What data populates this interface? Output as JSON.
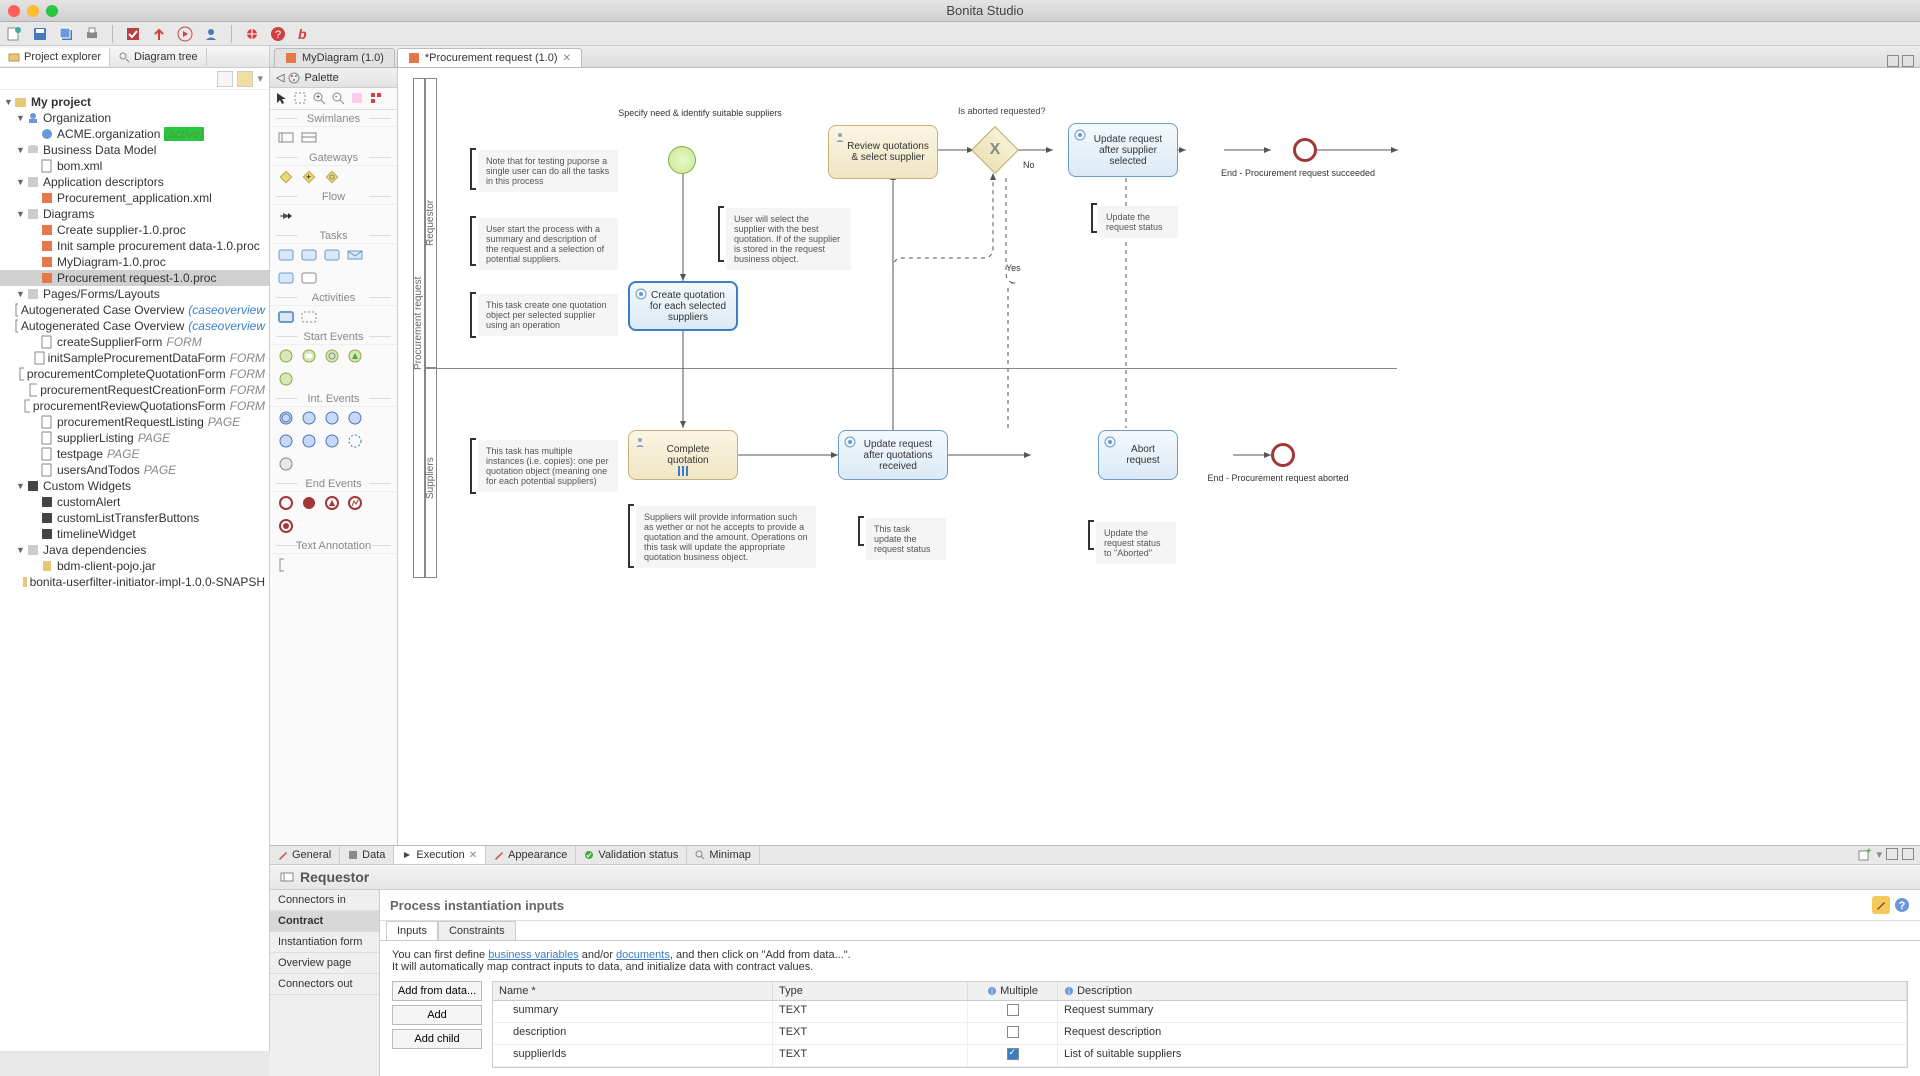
{
  "window": {
    "title": "Bonita Studio"
  },
  "left_tabs": {
    "explorer": "Project explorer",
    "tree": "Diagram tree"
  },
  "tree": {
    "root": "My project",
    "org": "Organization",
    "org_item": "ACME.organization",
    "org_suffix": "(active)",
    "bdm": "Business Data Model",
    "bdm_item": "bom.xml",
    "app": "Application descriptors",
    "app_item": "Procurement_application.xml",
    "diag": "Diagrams",
    "diag_items": [
      "Create supplier-1.0.proc",
      "Init sample procurement data-1.0.proc",
      "MyDiagram-1.0.proc",
      "Procurement request-1.0.proc"
    ],
    "pages": "Pages/Forms/Layouts",
    "pages_items": [
      {
        "l": "Autogenerated Case Overview",
        "s": "(caseoverview"
      },
      {
        "l": "Autogenerated Case Overview",
        "s": "(caseoverview"
      },
      {
        "l": "createSupplierForm",
        "s": "FORM"
      },
      {
        "l": "initSampleProcurementDataForm",
        "s": "FORM"
      },
      {
        "l": "procurementCompleteQuotationForm",
        "s": "FORM"
      },
      {
        "l": "procurementRequestCreationForm",
        "s": "FORM"
      },
      {
        "l": "procurementReviewQuotationsForm",
        "s": "FORM"
      },
      {
        "l": "procurementRequestListing",
        "s": "PAGE"
      },
      {
        "l": "supplierListing",
        "s": "PAGE"
      },
      {
        "l": "testpage",
        "s": "PAGE"
      },
      {
        "l": "usersAndTodos",
        "s": "PAGE"
      }
    ],
    "widgets": "Custom Widgets",
    "widgets_items": [
      "customAlert",
      "customListTransferButtons",
      "timelineWidget"
    ],
    "java": "Java dependencies",
    "java_items": [
      "bdm-client-pojo.jar",
      "bonita-userfilter-initiator-impl-1.0.0-SNAPSH"
    ]
  },
  "editor_tabs": {
    "t1": "MyDiagram (1.0)",
    "t2": "*Procurement request (1.0)"
  },
  "palette": {
    "title": "Palette",
    "groups": [
      "Swimlanes",
      "Gateways",
      "Flow",
      "Tasks",
      "Activities",
      "Start Events",
      "Int. Events",
      "End Events",
      "Text Annotation"
    ]
  },
  "canvas": {
    "proc_label": "Procurement request",
    "lane1": "Requestor",
    "lane2": "Suppliers",
    "lbl_title": "Specify need & identify suitable suppliers",
    "note1": "Note that for testing puporse a single user can do all the tasks in this process",
    "note2": "User start the process with a summary and description of the request and a selection of potential suppliers.",
    "note3": "This task create one quotation object per selected supplier using an operation",
    "note4": "User will select the supplier with the best quotation. If of the supplier is stored in the request business object.",
    "note5": "This task has multiple instances (i.e. copies): one per quotation object (meaning one for each potential suppliers)",
    "note6": "Suppliers will provide information such as wether or not he accepts to provide a quotation and the amount. Operations on this task will update the appropriate quotation business object.",
    "note7": "This task update the request status",
    "note8": "Update the request status",
    "note9": "Update the request status to \"Aborted\"",
    "task_create": "Create quotation for each selected suppliers",
    "task_review": "Review quotations & select supplier",
    "task_update_sel": "Update request after supplier selected",
    "task_complete": "Complete quotation",
    "task_update_rec": "Update request after quotations received",
    "task_abort": "Abort request",
    "gw": "Is aborted requested?",
    "gw_no": "No",
    "gw_yes": "Yes",
    "end1": "End - Procurement request succeeded",
    "end2": "End - Procurement request aborted"
  },
  "bottom_tabs": {
    "general": "General",
    "data": "Data",
    "exec": "Execution",
    "appear": "Appearance",
    "valid": "Validation status",
    "mini": "Minimap"
  },
  "requestor_hdr": "Requestor",
  "side": {
    "conn_in": "Connectors in",
    "contract": "Contract",
    "inst": "Instantiation form",
    "over": "Overview page",
    "conn_out": "Connectors out"
  },
  "form_title": "Process instantiation inputs",
  "subtabs": {
    "inputs": "Inputs",
    "constraints": "Constraints"
  },
  "help1": "You can first define ",
  "help_bv": "business variables",
  "help2": " and/or ",
  "help_doc": "documents",
  "help3": ", and then click on \"Add from data...\".",
  "help4": "It will automatically map contract inputs to data, and initialize data with contract values.",
  "btns": {
    "add_data": "Add from data...",
    "add": "Add",
    "add_child": "Add child"
  },
  "cols": {
    "name": "Name *",
    "type": "Type",
    "mult": "Multiple",
    "desc": "Description"
  },
  "rows": [
    {
      "name": "summary",
      "type": "TEXT",
      "mult": false,
      "desc": "Request summary"
    },
    {
      "name": "description",
      "type": "TEXT",
      "mult": false,
      "desc": "Request description"
    },
    {
      "name": "supplierIds",
      "type": "TEXT",
      "mult": true,
      "desc": "List of suitable suppliers"
    }
  ]
}
